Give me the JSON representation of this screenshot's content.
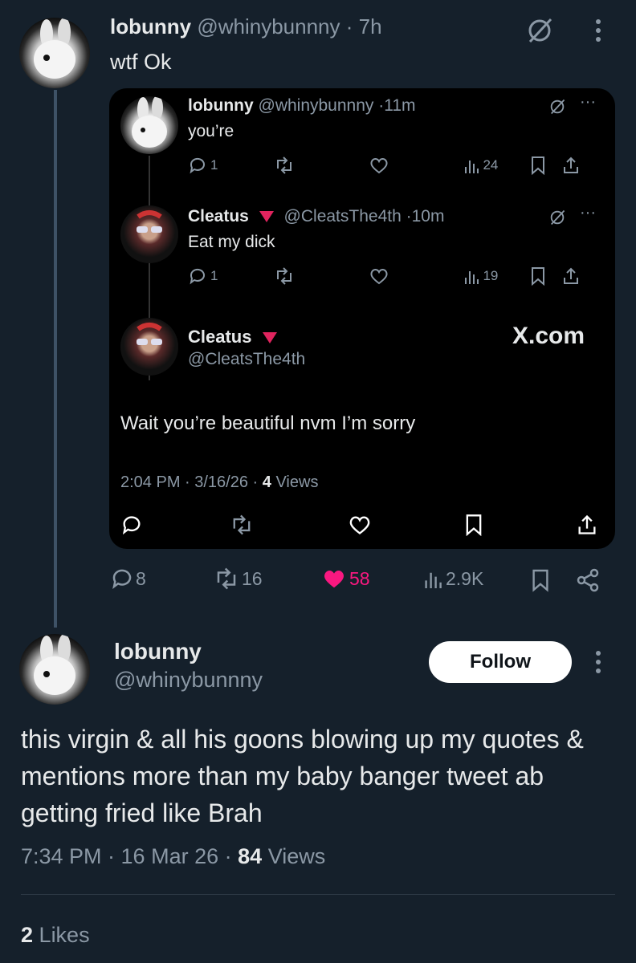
{
  "top_tweet": {
    "name": "lobunny",
    "handle": "@whinybunnny",
    "time": "· 7h",
    "text": "wtf Ok",
    "counts": {
      "replies": "8",
      "retweets": "16",
      "likes": "58",
      "views": "2.9K"
    }
  },
  "quote_card": {
    "reply1": {
      "name": "lobunny",
      "handle": "@whinybunnny",
      "time": "·11m",
      "text": "you’re",
      "replies": "1",
      "views": "24"
    },
    "reply2": {
      "name": "Cleatus",
      "handle": "@CleatsThe4th",
      "time": "·10m",
      "text": "Eat my dick",
      "replies": "1",
      "views": "19"
    },
    "main": {
      "name": "Cleatus",
      "handle": "@CleatsThe4th",
      "text": "Wait you’re beautiful nvm I’m sorry",
      "timestamp": "2:04 PM · 3/16/26 ·",
      "views_count": "4",
      "views_label": "Views",
      "watermark": "X.com"
    }
  },
  "bottom_tweet": {
    "name": "lobunny",
    "handle": "@whinybunnny",
    "follow_label": "Follow",
    "text": "this virgin & all his goons blowing up my quotes & mentions more than my baby banger tweet ab getting fried like Brah",
    "timestamp": "7:34 PM · 16 Mar 26 ·",
    "views_count": "84",
    "views_label": "Views",
    "likes_count": "2",
    "likes_label": "Likes"
  },
  "colors": {
    "background": "#15202b",
    "like_pink": "#f91880",
    "verified_red": "#e0245e",
    "muted": "#8b98a5"
  }
}
